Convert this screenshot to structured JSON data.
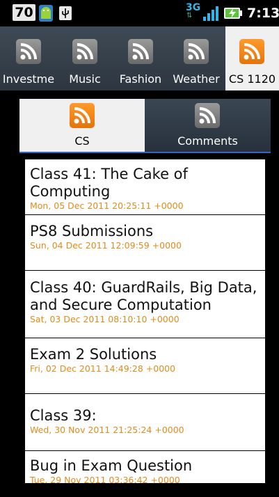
{
  "status_bar": {
    "badge": "70",
    "network": "3G",
    "time": "7:13"
  },
  "category_tabs": [
    {
      "label": "Investme",
      "icon": "rss-feed-icon",
      "selected": false
    },
    {
      "label": "Music",
      "icon": "rss-feed-icon",
      "selected": false
    },
    {
      "label": "Fashion",
      "icon": "rss-feed-icon",
      "selected": false
    },
    {
      "label": "Weather",
      "icon": "rss-feed-icon",
      "selected": false
    },
    {
      "label": "CS 1120",
      "icon": "rss-feed-icon",
      "selected": true
    }
  ],
  "sub_tabs": [
    {
      "label": "CS",
      "icon": "rss-feed-icon",
      "selected": true
    },
    {
      "label": "Comments",
      "icon": "rss-feed-icon",
      "selected": false
    }
  ],
  "articles": [
    {
      "title": "Class 41: The Cake of Computing",
      "date": "Mon, 05 Dec 2011 20:25:11 +0000"
    },
    {
      "title": "PS8 Submissions",
      "date": "Sun, 04 Dec 2011 12:09:59 +0000"
    },
    {
      "title": "Class 40: GuardRails, Big Data, and Secure Computation",
      "date": "Sat, 03 Dec 2011 08:10:10 +0000"
    },
    {
      "title": "Exam 2 Solutions",
      "date": "Fri, 02 Dec 2011 14:49:28 +0000"
    },
    {
      "title": "Class 39:",
      "date": "Wed, 30 Nov 2011 21:25:24 +0000"
    },
    {
      "title": "Bug in Exam Question",
      "date": "Tue, 29 Nov 2011 03:36:42 +0000"
    }
  ],
  "colors": {
    "accent_orange": "#e48a1c",
    "tab_bg": "#2d3640",
    "selected_tab_bg": "#f0f0f0"
  }
}
